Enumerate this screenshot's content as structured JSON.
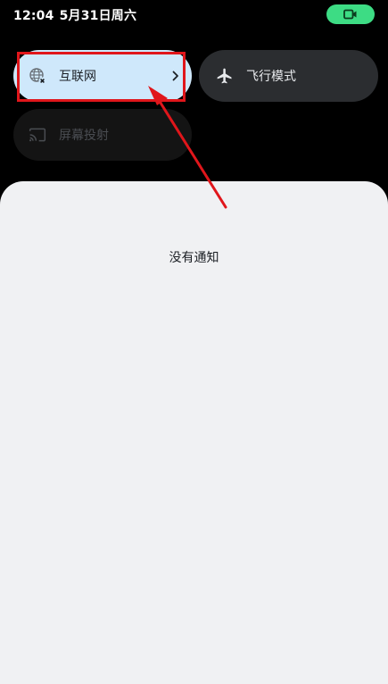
{
  "status_bar": {
    "time": "12:04",
    "date": "5月31日周六",
    "call_icon": "video-camera-icon",
    "call_color": "#3ddc84"
  },
  "quick_settings": {
    "tiles": [
      {
        "label": "互联网",
        "icon": "globe-no-signal-icon",
        "state": "active",
        "has_chevron": true
      },
      {
        "label": "飞行模式",
        "icon": "airplane-icon",
        "state": "inactive"
      },
      {
        "label": "屏幕投射",
        "icon": "cast-icon",
        "state": "unavailable"
      }
    ]
  },
  "annotation": {
    "highlight_color": "#e0161b"
  },
  "notifications": {
    "empty_text": "没有通知"
  }
}
